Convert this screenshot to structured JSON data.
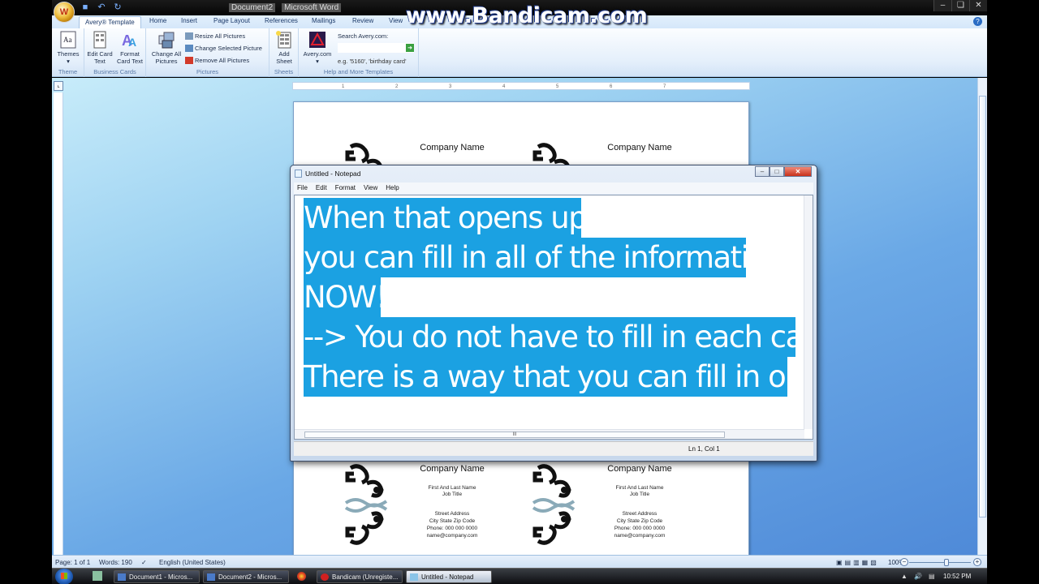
{
  "watermark": "www.Bandicam.com",
  "titlebar": {
    "doc_name": "Document2",
    "app_name": "Microsoft Word",
    "orb_label": "W",
    "qat": [
      "save-icon",
      "undo-icon",
      "redo-icon"
    ],
    "controls": {
      "minimize": "–",
      "restore": "❏",
      "close": "✕"
    }
  },
  "tabs": [
    {
      "label": "Avery® Template",
      "active": true
    },
    {
      "label": "Home"
    },
    {
      "label": "Insert"
    },
    {
      "label": "Page Layout"
    },
    {
      "label": "References"
    },
    {
      "label": "Mailings"
    },
    {
      "label": "Review"
    },
    {
      "label": "View"
    }
  ],
  "ribbon": {
    "theme": {
      "group": "Theme",
      "themes": "Themes"
    },
    "business_cards": {
      "group": "Business Cards",
      "edit_card_text": "Edit Card Text",
      "format_card_text": "Format Card Text"
    },
    "pictures": {
      "group": "Pictures",
      "change_all": "Change All Pictures",
      "resize_all": "Resize All Pictures",
      "change_selected": "Change Selected Picture",
      "remove_all": "Remove All Pictures"
    },
    "sheets": {
      "group": "Sheets",
      "add_sheet": "Add Sheet"
    },
    "help": {
      "group": "Help and More Templates",
      "avery_com": "Avery.com",
      "search_label": "Search Avery.com:",
      "search_placeholder": "e.g. '5160', 'birthday card'"
    }
  },
  "ruler": {
    "ticks": [
      "1",
      "2",
      "3",
      "4",
      "5",
      "6",
      "7"
    ]
  },
  "cards": {
    "company": "Company Name",
    "name": "First And Last Name",
    "job": "Job Title",
    "street": "Street Address",
    "city": "City State Zip Code",
    "phone": "Phone: 000 000 0000",
    "email": "name@company.com"
  },
  "notepad": {
    "title": "Untitled - Notepad",
    "menu": [
      "File",
      "Edit",
      "Format",
      "View",
      "Help"
    ],
    "lines": [
      "When that opens up,",
      "you can fill in all of the information",
      "NOW!!!",
      "--> You do not have to fill in each card",
      "There is a way that you can fill in one"
    ],
    "hscroll_grip": "III",
    "status": "Ln 1, Col 1",
    "controls": {
      "minimize": "–",
      "maximize": "□",
      "close": "✕"
    }
  },
  "statusbar": {
    "page": "Page: 1 of 1",
    "words": "Words: 190",
    "language": "English (United States)",
    "zoom": "100%",
    "zoom_level_percent": 100
  },
  "taskbar": {
    "items": [
      {
        "label": "Document1 - Micros...",
        "icon": "word-doc-icon"
      },
      {
        "label": "Document2 - Micros...",
        "icon": "word-doc-icon"
      },
      {
        "label": "Bandicam (Unregiste...",
        "icon": "bandicam-icon"
      },
      {
        "label": "Untitled - Notepad",
        "icon": "notepad-icon",
        "active": true
      }
    ],
    "clock": "10:52 PM"
  },
  "colors": {
    "selection": "#1ba1e2",
    "ribbon_text": "#1c2c48",
    "close_red": "#c8301a"
  }
}
